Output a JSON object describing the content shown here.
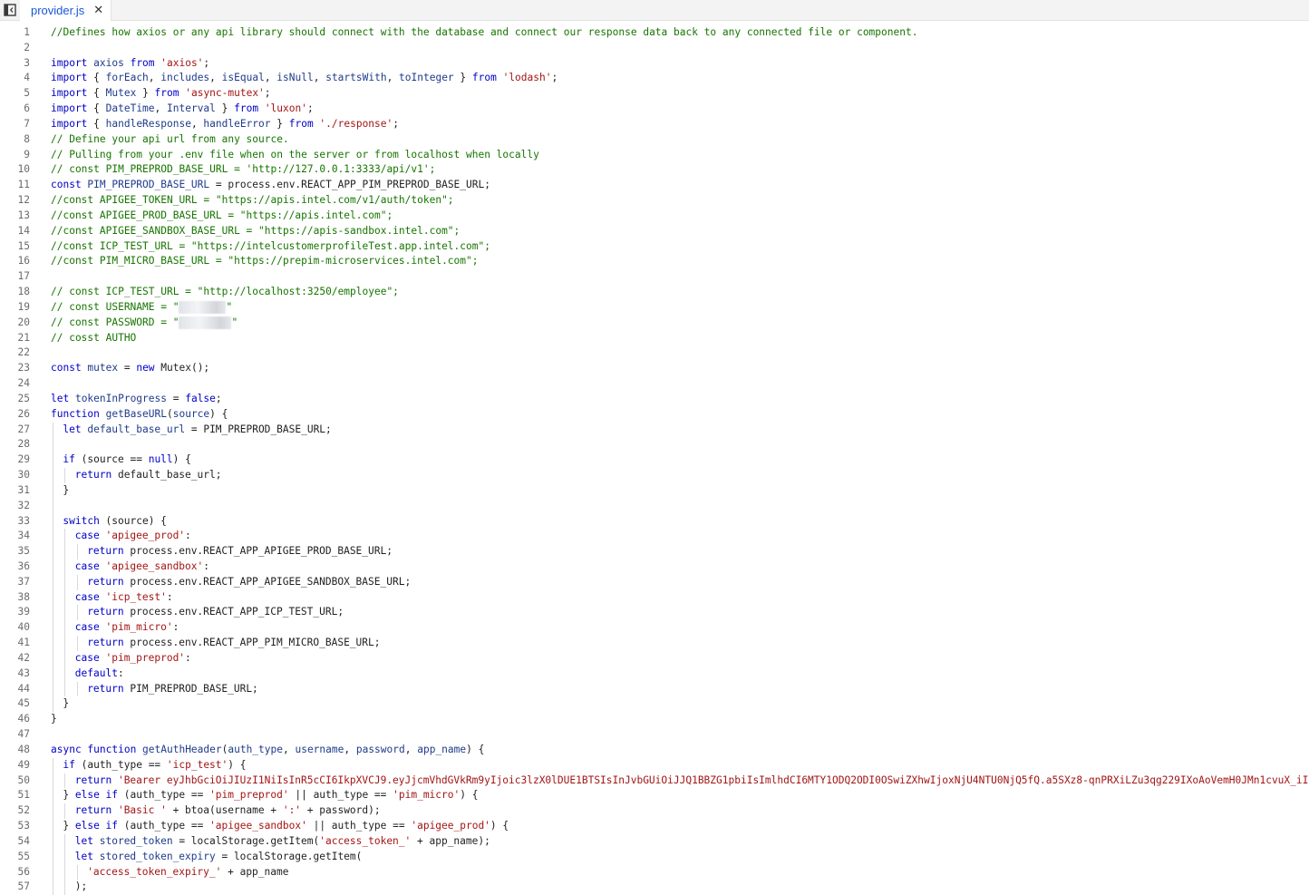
{
  "editor": {
    "tab": {
      "label": "provider.js",
      "close_glyph": "✕"
    },
    "icons": {
      "sidebar_toggle": "sidebar-toggle-icon"
    },
    "colors": {
      "comment": "#177500",
      "keyword": "#0000c8",
      "string": "#a31515",
      "identifier": "#1f3b8a",
      "line_number": "#6b6b6b",
      "tab_label": "#1a56db"
    },
    "lines": [
      {
        "n": "1",
        "indent": 0,
        "tokens": [
          {
            "t": "//Defines how axios or any api library should connect with the database and connect our response data back to any connected file or component.",
            "c": "t-com"
          }
        ]
      },
      {
        "n": "2",
        "indent": 0,
        "tokens": []
      },
      {
        "n": "3",
        "indent": 0,
        "tokens": [
          {
            "t": "import ",
            "c": "t-kw"
          },
          {
            "t": "axios ",
            "c": "t-id"
          },
          {
            "t": "from ",
            "c": "t-kw"
          },
          {
            "t": "'axios'",
            "c": "t-str"
          },
          {
            "t": ";",
            "c": "t-plain"
          }
        ]
      },
      {
        "n": "4",
        "indent": 0,
        "tokens": [
          {
            "t": "import ",
            "c": "t-kw"
          },
          {
            "t": "{ ",
            "c": "t-plain"
          },
          {
            "t": "forEach",
            "c": "t-id"
          },
          {
            "t": ", ",
            "c": "t-plain"
          },
          {
            "t": "includes",
            "c": "t-id"
          },
          {
            "t": ", ",
            "c": "t-plain"
          },
          {
            "t": "isEqual",
            "c": "t-id"
          },
          {
            "t": ", ",
            "c": "t-plain"
          },
          {
            "t": "isNull",
            "c": "t-id"
          },
          {
            "t": ", ",
            "c": "t-plain"
          },
          {
            "t": "startsWith",
            "c": "t-id"
          },
          {
            "t": ", ",
            "c": "t-plain"
          },
          {
            "t": "toInteger",
            "c": "t-id"
          },
          {
            "t": " } ",
            "c": "t-plain"
          },
          {
            "t": "from ",
            "c": "t-kw"
          },
          {
            "t": "'lodash'",
            "c": "t-str"
          },
          {
            "t": ";",
            "c": "t-plain"
          }
        ]
      },
      {
        "n": "5",
        "indent": 0,
        "tokens": [
          {
            "t": "import ",
            "c": "t-kw"
          },
          {
            "t": "{ ",
            "c": "t-plain"
          },
          {
            "t": "Mutex",
            "c": "t-id"
          },
          {
            "t": " } ",
            "c": "t-plain"
          },
          {
            "t": "from ",
            "c": "t-kw"
          },
          {
            "t": "'async-mutex'",
            "c": "t-str"
          },
          {
            "t": ";",
            "c": "t-plain"
          }
        ]
      },
      {
        "n": "6",
        "indent": 0,
        "tokens": [
          {
            "t": "import ",
            "c": "t-kw"
          },
          {
            "t": "{ ",
            "c": "t-plain"
          },
          {
            "t": "DateTime",
            "c": "t-id"
          },
          {
            "t": ", ",
            "c": "t-plain"
          },
          {
            "t": "Interval",
            "c": "t-id"
          },
          {
            "t": " } ",
            "c": "t-plain"
          },
          {
            "t": "from ",
            "c": "t-kw"
          },
          {
            "t": "'luxon'",
            "c": "t-str"
          },
          {
            "t": ";",
            "c": "t-plain"
          }
        ]
      },
      {
        "n": "7",
        "indent": 0,
        "tokens": [
          {
            "t": "import ",
            "c": "t-kw"
          },
          {
            "t": "{ ",
            "c": "t-plain"
          },
          {
            "t": "handleResponse",
            "c": "t-id"
          },
          {
            "t": ", ",
            "c": "t-plain"
          },
          {
            "t": "handleError",
            "c": "t-id"
          },
          {
            "t": " } ",
            "c": "t-plain"
          },
          {
            "t": "from ",
            "c": "t-kw"
          },
          {
            "t": "'./response'",
            "c": "t-str"
          },
          {
            "t": ";",
            "c": "t-plain"
          }
        ]
      },
      {
        "n": "8",
        "indent": 0,
        "tokens": [
          {
            "t": "// Define your api url from any source.",
            "c": "t-com"
          }
        ]
      },
      {
        "n": "9",
        "indent": 0,
        "tokens": [
          {
            "t": "// Pulling from your .env file when on the server or from localhost when locally",
            "c": "t-com"
          }
        ]
      },
      {
        "n": "10",
        "indent": 0,
        "tokens": [
          {
            "t": "// const PIM_PREPROD_BASE_URL = 'http://127.0.0.1:3333/api/v1';",
            "c": "t-com"
          }
        ]
      },
      {
        "n": "11",
        "indent": 0,
        "tokens": [
          {
            "t": "const ",
            "c": "t-kw"
          },
          {
            "t": "PIM_PREPROD_BASE_URL",
            "c": "t-id"
          },
          {
            "t": " = process.env.REACT_APP_PIM_PREPROD_BASE_URL;",
            "c": "t-plain"
          }
        ]
      },
      {
        "n": "12",
        "indent": 0,
        "tokens": [
          {
            "t": "//const APIGEE_TOKEN_URL = \"https://apis.intel.com/v1/auth/token\";",
            "c": "t-com"
          }
        ]
      },
      {
        "n": "13",
        "indent": 0,
        "tokens": [
          {
            "t": "//const APIGEE_PROD_BASE_URL = \"https://apis.intel.com\";",
            "c": "t-com"
          }
        ]
      },
      {
        "n": "14",
        "indent": 0,
        "tokens": [
          {
            "t": "//const APIGEE_SANDBOX_BASE_URL = \"https://apis-sandbox.intel.com\";",
            "c": "t-com"
          }
        ]
      },
      {
        "n": "15",
        "indent": 0,
        "tokens": [
          {
            "t": "//const ICP_TEST_URL = \"https://intelcustomerprofileTest.app.intel.com\";",
            "c": "t-com"
          }
        ]
      },
      {
        "n": "16",
        "indent": 0,
        "tokens": [
          {
            "t": "//const PIM_MICRO_BASE_URL = \"https://prepim-microservices.intel.com\";",
            "c": "t-com"
          }
        ]
      },
      {
        "n": "17",
        "indent": 0,
        "tokens": []
      },
      {
        "n": "18",
        "indent": 0,
        "tokens": [
          {
            "t": "// const ICP_TEST_URL = \"http://localhost:3250/employee\";",
            "c": "t-com"
          }
        ]
      },
      {
        "n": "19",
        "indent": 0,
        "tokens": [
          {
            "t": "// const USERNAME = \"",
            "c": "t-com"
          },
          {
            "t": "",
            "c": "blur",
            "w": 52
          },
          {
            "t": "\"",
            "c": "t-com"
          }
        ]
      },
      {
        "n": "20",
        "indent": 0,
        "tokens": [
          {
            "t": "// const PASSWORD = \"",
            "c": "t-com"
          },
          {
            "t": "",
            "c": "blur",
            "w": 58
          },
          {
            "t": "\"",
            "c": "t-com"
          }
        ]
      },
      {
        "n": "21",
        "indent": 0,
        "tokens": [
          {
            "t": "// cosst AUTHO",
            "c": "t-com"
          }
        ]
      },
      {
        "n": "22",
        "indent": 0,
        "tokens": []
      },
      {
        "n": "23",
        "indent": 0,
        "tokens": [
          {
            "t": "const ",
            "c": "t-kw"
          },
          {
            "t": "mutex",
            "c": "t-id"
          },
          {
            "t": " = ",
            "c": "t-plain"
          },
          {
            "t": "new ",
            "c": "t-kw"
          },
          {
            "t": "Mutex();",
            "c": "t-plain"
          }
        ]
      },
      {
        "n": "24",
        "indent": 0,
        "tokens": []
      },
      {
        "n": "25",
        "indent": 0,
        "tokens": [
          {
            "t": "let ",
            "c": "t-kw"
          },
          {
            "t": "tokenInProgress",
            "c": "t-id"
          },
          {
            "t": " = ",
            "c": "t-plain"
          },
          {
            "t": "false",
            "c": "t-kw"
          },
          {
            "t": ";",
            "c": "t-plain"
          }
        ]
      },
      {
        "n": "26",
        "indent": 0,
        "tokens": [
          {
            "t": "function ",
            "c": "t-kw"
          },
          {
            "t": "getBaseURL",
            "c": "t-id"
          },
          {
            "t": "(",
            "c": "t-plain"
          },
          {
            "t": "source",
            "c": "t-id"
          },
          {
            "t": ") {",
            "c": "t-plain"
          }
        ]
      },
      {
        "n": "27",
        "indent": 1,
        "tokens": [
          {
            "t": "let ",
            "c": "t-kw"
          },
          {
            "t": "default_base_url",
            "c": "t-id"
          },
          {
            "t": " = PIM_PREPROD_BASE_URL;",
            "c": "t-plain"
          }
        ]
      },
      {
        "n": "28",
        "indent": 1,
        "tokens": []
      },
      {
        "n": "29",
        "indent": 1,
        "tokens": [
          {
            "t": "if ",
            "c": "t-kw"
          },
          {
            "t": "(source == ",
            "c": "t-plain"
          },
          {
            "t": "null",
            "c": "t-kw"
          },
          {
            "t": ") {",
            "c": "t-plain"
          }
        ]
      },
      {
        "n": "30",
        "indent": 2,
        "tokens": [
          {
            "t": "return ",
            "c": "t-kw"
          },
          {
            "t": "default_base_url;",
            "c": "t-plain"
          }
        ]
      },
      {
        "n": "31",
        "indent": 1,
        "tokens": [
          {
            "t": "}",
            "c": "t-plain"
          }
        ]
      },
      {
        "n": "32",
        "indent": 1,
        "tokens": []
      },
      {
        "n": "33",
        "indent": 1,
        "tokens": [
          {
            "t": "switch ",
            "c": "t-kw"
          },
          {
            "t": "(source) {",
            "c": "t-plain"
          }
        ]
      },
      {
        "n": "34",
        "indent": 2,
        "tokens": [
          {
            "t": "case ",
            "c": "t-kw"
          },
          {
            "t": "'apigee_prod'",
            "c": "t-str"
          },
          {
            "t": ":",
            "c": "t-plain"
          }
        ]
      },
      {
        "n": "35",
        "indent": 3,
        "tokens": [
          {
            "t": "return ",
            "c": "t-kw"
          },
          {
            "t": "process.env.REACT_APP_APIGEE_PROD_BASE_URL;",
            "c": "t-plain"
          }
        ]
      },
      {
        "n": "36",
        "indent": 2,
        "tokens": [
          {
            "t": "case ",
            "c": "t-kw"
          },
          {
            "t": "'apigee_sandbox'",
            "c": "t-str"
          },
          {
            "t": ":",
            "c": "t-plain"
          }
        ]
      },
      {
        "n": "37",
        "indent": 3,
        "tokens": [
          {
            "t": "return ",
            "c": "t-kw"
          },
          {
            "t": "process.env.REACT_APP_APIGEE_SANDBOX_BASE_URL;",
            "c": "t-plain"
          }
        ]
      },
      {
        "n": "38",
        "indent": 2,
        "tokens": [
          {
            "t": "case ",
            "c": "t-kw"
          },
          {
            "t": "'icp_test'",
            "c": "t-str"
          },
          {
            "t": ":",
            "c": "t-plain"
          }
        ]
      },
      {
        "n": "39",
        "indent": 3,
        "tokens": [
          {
            "t": "return ",
            "c": "t-kw"
          },
          {
            "t": "process.env.REACT_APP_ICP_TEST_URL;",
            "c": "t-plain"
          }
        ]
      },
      {
        "n": "40",
        "indent": 2,
        "tokens": [
          {
            "t": "case ",
            "c": "t-kw"
          },
          {
            "t": "'pim_micro'",
            "c": "t-str"
          },
          {
            "t": ":",
            "c": "t-plain"
          }
        ]
      },
      {
        "n": "41",
        "indent": 3,
        "tokens": [
          {
            "t": "return ",
            "c": "t-kw"
          },
          {
            "t": "process.env.REACT_APP_PIM_MICRO_BASE_URL;",
            "c": "t-plain"
          }
        ]
      },
      {
        "n": "42",
        "indent": 2,
        "tokens": [
          {
            "t": "case ",
            "c": "t-kw"
          },
          {
            "t": "'pim_preprod'",
            "c": "t-str"
          },
          {
            "t": ":",
            "c": "t-plain"
          }
        ]
      },
      {
        "n": "43",
        "indent": 2,
        "tokens": [
          {
            "t": "default",
            "c": "t-kw"
          },
          {
            "t": ":",
            "c": "t-plain"
          }
        ]
      },
      {
        "n": "44",
        "indent": 3,
        "tokens": [
          {
            "t": "return ",
            "c": "t-kw"
          },
          {
            "t": "PIM_PREPROD_BASE_URL;",
            "c": "t-plain"
          }
        ]
      },
      {
        "n": "45",
        "indent": 1,
        "tokens": [
          {
            "t": "}",
            "c": "t-plain"
          }
        ]
      },
      {
        "n": "46",
        "indent": 0,
        "tokens": [
          {
            "t": "}",
            "c": "t-plain"
          }
        ]
      },
      {
        "n": "47",
        "indent": 0,
        "tokens": []
      },
      {
        "n": "48",
        "indent": 0,
        "tokens": [
          {
            "t": "async ",
            "c": "t-kw"
          },
          {
            "t": "function ",
            "c": "t-kw"
          },
          {
            "t": "getAuthHeader",
            "c": "t-id"
          },
          {
            "t": "(",
            "c": "t-plain"
          },
          {
            "t": "auth_type",
            "c": "t-id"
          },
          {
            "t": ", ",
            "c": "t-plain"
          },
          {
            "t": "username",
            "c": "t-id"
          },
          {
            "t": ", ",
            "c": "t-plain"
          },
          {
            "t": "password",
            "c": "t-id"
          },
          {
            "t": ", ",
            "c": "t-plain"
          },
          {
            "t": "app_name",
            "c": "t-id"
          },
          {
            "t": ") {",
            "c": "t-plain"
          }
        ]
      },
      {
        "n": "49",
        "indent": 1,
        "tokens": [
          {
            "t": "if ",
            "c": "t-kw"
          },
          {
            "t": "(auth_type == ",
            "c": "t-plain"
          },
          {
            "t": "'icp_test'",
            "c": "t-str"
          },
          {
            "t": ") {",
            "c": "t-plain"
          }
        ]
      },
      {
        "n": "50",
        "indent": 2,
        "tokens": [
          {
            "t": "return ",
            "c": "t-kw"
          },
          {
            "t": "'Bearer eyJhbGciOiJIUzI1NiIsInR5cCI6IkpXVCJ9.eyJjcmVhdGVkRm9yIjoic3lzX0lDUE1BTSIsInJvbGUiOiJJQ1BBZG1pbiIsImlhdCI6MTY1ODQ2ODI0OSwiZXhwIjoxNjU4NTU0NjQ5fQ.a5SXz8-qnPRXiLZu3qg229IXoAoVemH0JMn1cvuX_iI'",
            "c": "t-str"
          },
          {
            "t": ";",
            "c": "t-plain"
          }
        ]
      },
      {
        "n": "51",
        "indent": 1,
        "tokens": [
          {
            "t": "} ",
            "c": "t-plain"
          },
          {
            "t": "else if ",
            "c": "t-kw"
          },
          {
            "t": "(auth_type == ",
            "c": "t-plain"
          },
          {
            "t": "'pim_preprod'",
            "c": "t-str"
          },
          {
            "t": " || auth_type == ",
            "c": "t-plain"
          },
          {
            "t": "'pim_micro'",
            "c": "t-str"
          },
          {
            "t": ") {",
            "c": "t-plain"
          }
        ]
      },
      {
        "n": "52",
        "indent": 2,
        "tokens": [
          {
            "t": "return ",
            "c": "t-kw"
          },
          {
            "t": "'Basic '",
            "c": "t-str"
          },
          {
            "t": " + btoa(username + ",
            "c": "t-plain"
          },
          {
            "t": "':'",
            "c": "t-str"
          },
          {
            "t": " + password);",
            "c": "t-plain"
          }
        ]
      },
      {
        "n": "53",
        "indent": 1,
        "tokens": [
          {
            "t": "} ",
            "c": "t-plain"
          },
          {
            "t": "else if ",
            "c": "t-kw"
          },
          {
            "t": "(auth_type == ",
            "c": "t-plain"
          },
          {
            "t": "'apigee_sandbox'",
            "c": "t-str"
          },
          {
            "t": " || auth_type == ",
            "c": "t-plain"
          },
          {
            "t": "'apigee_prod'",
            "c": "t-str"
          },
          {
            "t": ") {",
            "c": "t-plain"
          }
        ]
      },
      {
        "n": "54",
        "indent": 2,
        "tokens": [
          {
            "t": "let ",
            "c": "t-kw"
          },
          {
            "t": "stored_token",
            "c": "t-id"
          },
          {
            "t": " = localStorage.getItem(",
            "c": "t-plain"
          },
          {
            "t": "'access_token_'",
            "c": "t-str"
          },
          {
            "t": " + app_name);",
            "c": "t-plain"
          }
        ]
      },
      {
        "n": "55",
        "indent": 2,
        "tokens": [
          {
            "t": "let ",
            "c": "t-kw"
          },
          {
            "t": "stored_token_expiry",
            "c": "t-id"
          },
          {
            "t": " = localStorage.getItem(",
            "c": "t-plain"
          }
        ]
      },
      {
        "n": "56",
        "indent": 3,
        "tokens": [
          {
            "t": "'access_token_expiry_'",
            "c": "t-str"
          },
          {
            "t": " + app_name",
            "c": "t-plain"
          }
        ]
      },
      {
        "n": "57",
        "indent": 2,
        "tokens": [
          {
            "t": ");",
            "c": "t-plain"
          }
        ]
      }
    ]
  }
}
